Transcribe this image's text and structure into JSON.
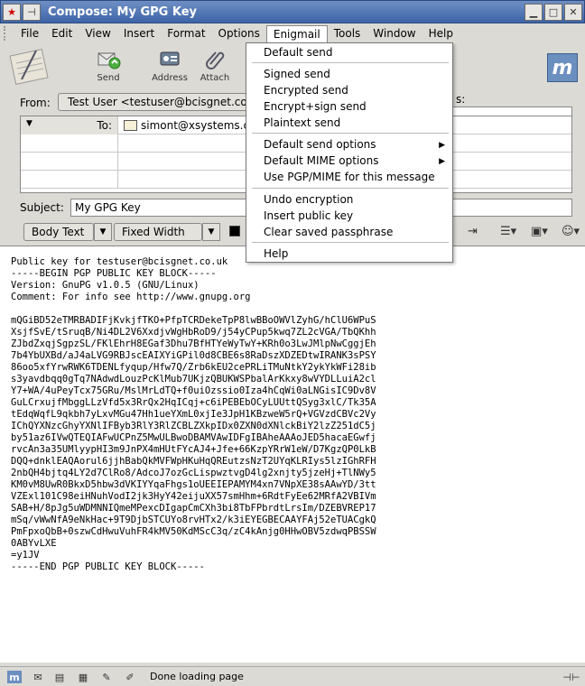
{
  "window": {
    "title": "Compose: My GPG Key"
  },
  "menubar": [
    "File",
    "Edit",
    "View",
    "Insert",
    "Format",
    "Options",
    "Enigmail",
    "Tools",
    "Window",
    "Help"
  ],
  "toolbar": {
    "send": "Send",
    "address": "Address",
    "attach": "Attach"
  },
  "header": {
    "from_label": "From:",
    "from_value": "Test User <testuser@bcisgnet.co.uk",
    "to_label": "To:",
    "to_value": "simont@xsystems.co",
    "attachments_label": "s:",
    "subject_label": "Subject:",
    "subject_value": "My GPG Key"
  },
  "format": {
    "paragraph": "Body Text",
    "font": "Fixed Width"
  },
  "enigmail_menu": [
    "Default send",
    "Signed send",
    "Encrypted send",
    "Encrypt+sign send",
    "Plaintext send",
    "Default send options",
    "Default MIME options",
    "Use PGP/MIME for this message",
    "Undo encryption",
    "Insert public key",
    "Clear saved passphrase",
    "Help"
  ],
  "body_lines": [
    "Public key for testuser@bcisgnet.co.uk",
    "-----BEGIN PGP PUBLIC KEY BLOCK-----",
    "Version: GnuPG v1.0.5 (GNU/Linux)",
    "Comment: For info see http://www.gnupg.org",
    "",
    "mQGiBD52eTMRBADIFjKvkjfTKO+PfpTCRDekeTpP8lwBBoOWVlZyhG/hClU6WPuS",
    "XsjfSvE/tSruqB/Ni4DL2V6XxdjvWgHbRoD9/j54yCPup5kwq7ZL2cVGA/TbQKhh",
    "ZJbdZxqjSgpzSL/FKlEhrH8EGaf3Dhu7BfHTYeWyTwY+KRh0o3LwJMlpNwCggjEh",
    "7b4YbUXBd/aJ4aLVG9RBJscEAIXYiGPil0d8CBE6s8RaDszXDZEDtwIRANK3sPSY",
    "86oo5xfYrwRWK6TDENLfyqup/Hfw7Q/Zrb6kEU2cePRLiTMuNtkY2ykYkWFi28ib",
    "s3yavdbqq0gTq7NAdwdLouzPcKlMub7UKjzQBUKWSPbalArKkxy8wVYDLLuiA2cl",
    "Y7+WA/4uPeyTcx75GRu/MslMrLdTQ+f0uiOzssio0Iza4hCqWi0aLNGisIC9Dv8V",
    "GuLCrxujfMbggLLzVfd5x3RrQx2HqICqj+c6iPEBEbOCyLUUttQSyg3xlC/Tk35A",
    "tEdqWqfL9qkbh7yLxvMGu47Hh1ueYXmL0xjIe3JpH1KBzweW5rQ+VGVzdCBVc2Vy",
    "IChQYXNzcGhyYXNlIFByb3RlY3RlZCBLZXkpIDx0ZXN0dXNlckBiY2lzZ251dC5j",
    "by51az6IVwQTEQIAFwUCPnZ5MwULBwoDBAMVAwIDFgIBAheAAAoJED5hacaEGwfj",
    "rvcAn3a35UMlyypHI3m9JnPX4mHUtFYcAJ4+Jfe+66KzpYRrW1eW/D7KgzQP0LkB",
    "DQQ+dnklEAQAorul6jjhBabQkMVFWpHKuHqQREutzsNzT2UYqKLRIys5lzIGhRFH",
    "2nbQH4bjtq4LY2d7ClRo8/AdcoJ7ozGcLispwztvgD4lg2xnjty5jzeHj+TlNWy5",
    "KM0vM8UwR0BkxD5hbw3dVKIYYqaFhgs1oUEEIEPAMYM4xn7VNpXE38sAAwYD/3tt",
    "VZExl101C98eiHNuhVodI2jk3HyY42eijuXX57smHhm+6RdtFyEe62MRfA2VBIVm",
    "SAB+H/8pJg5uWDMNNIQmeMPexcDIgapCmCXh3bi8TbFPbrdtLrsIm/DZEBVREP17",
    "mSq/vWwNfA9eNkHac+9T9DjbSTCUYo8rvHTx2/k3iEYEGBECAAYFAj52eTUACgkQ",
    "PmFpxoQbB+0szwCdHwuVuhFR4kMV50KdMScC3q/zC4kAnjg0HHwOBV5zdwqPBSSW",
    "0ABYvLXE",
    "=y1JV",
    "-----END PGP PUBLIC KEY BLOCK-----"
  ],
  "status": {
    "text": "Done loading page"
  },
  "icons": [
    "close-icon",
    "pin-icon",
    "minimize-icon",
    "maximize-icon",
    "window-close-icon",
    "send-icon",
    "address-icon",
    "attach-icon"
  ]
}
